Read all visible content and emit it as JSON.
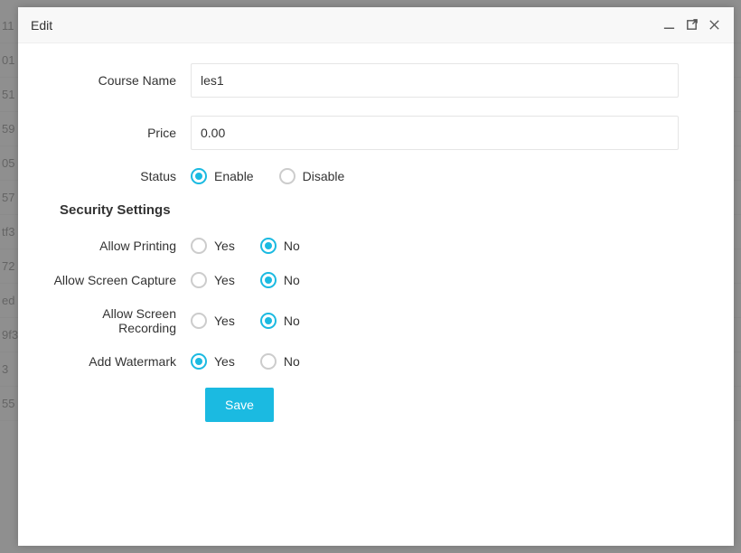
{
  "modal": {
    "title": "Edit",
    "save_label": "Save"
  },
  "fields": {
    "course_name_label": "Course Name",
    "course_name_value": "les1",
    "price_label": "Price",
    "price_value": "0.00",
    "status_label": "Status",
    "status_enable": "Enable",
    "status_disable": "Disable",
    "status_selected": "enable"
  },
  "security": {
    "section_title": "Security Settings",
    "yes": "Yes",
    "no": "No",
    "allow_printing_label": "Allow Printing",
    "allow_printing_selected": "no",
    "allow_screen_capture_label": "Allow Screen Capture",
    "allow_screen_capture_selected": "no",
    "allow_screen_recording_label": "Allow Screen Recording",
    "allow_screen_recording_selected": "no",
    "add_watermark_label": "Add Watermark",
    "add_watermark_selected": "yes"
  },
  "bg_rows": [
    "11",
    "01",
    "51",
    "59",
    "05",
    "57",
    "tf3",
    "72",
    "ed",
    "9f3",
    "3",
    "55"
  ]
}
